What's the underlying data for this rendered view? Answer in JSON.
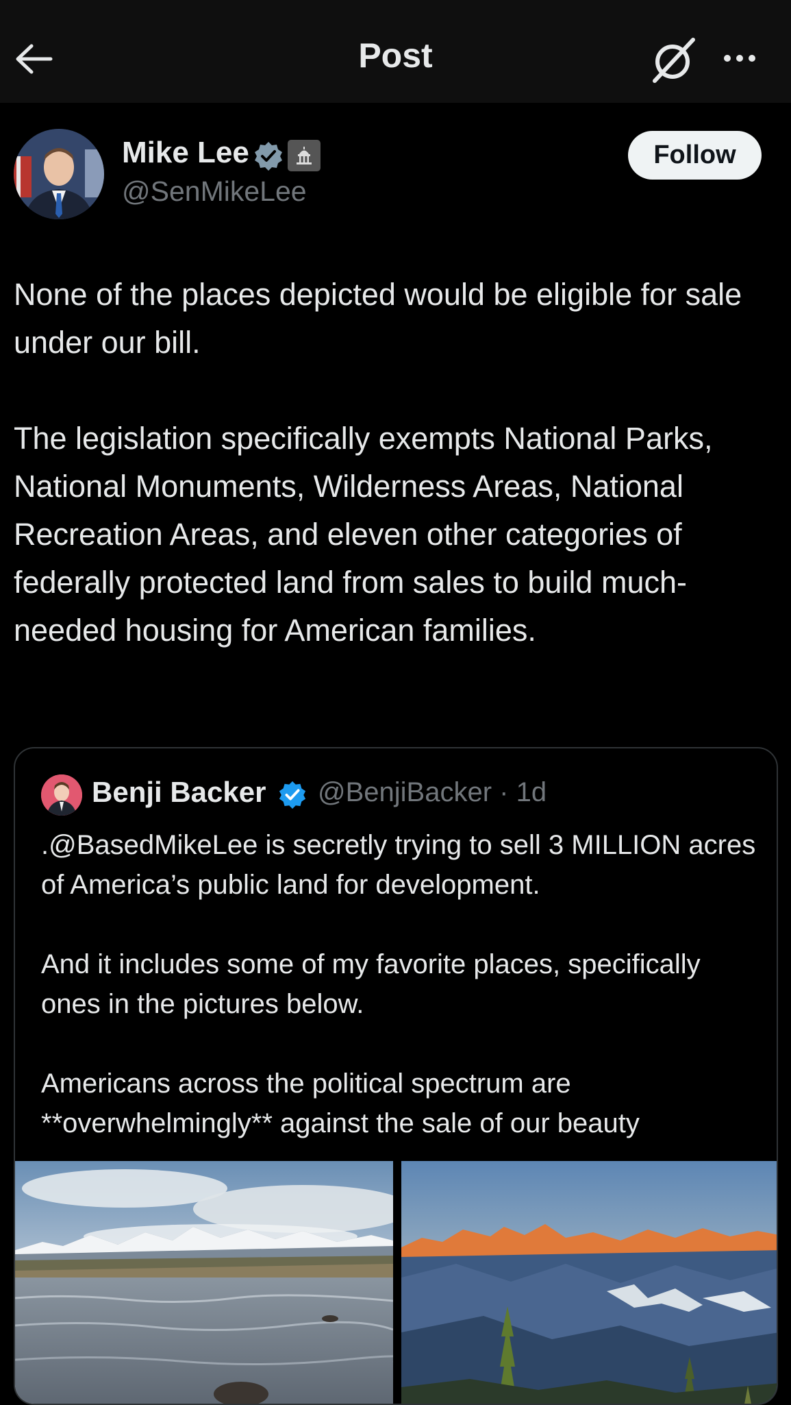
{
  "header": {
    "title": "Post"
  },
  "post": {
    "author_name": "Mike Lee",
    "author_handle": "@SenMikeLee",
    "follow_label": "Follow",
    "paragraphs": [
      "None of the places depicted would be eligible for sale under our bill.",
      "The legislation specifically exempts National Parks, National Monuments, Wilderness Areas, National Recreation Areas, and eleven other categories of federally protected land from sales to build much-needed housing for American families."
    ]
  },
  "quote": {
    "author_name": "Benji Backer",
    "author_handle": "@BenjiBacker · 1d",
    "paragraphs": [
      ".@BasedMikeLee is secretly trying to sell 3 MILLION acres of America’s public land for development.",
      "And it includes some of my favorite places, specifically ones in the pictures below.",
      "Americans across the political spectrum are **overwhelmingly** against the sale of our beauty"
    ],
    "images": [
      "lake-mountains-photo",
      "alpine-sunset-photo"
    ]
  },
  "colors": {
    "background": "#000000",
    "header_bg": "#0f0f0f",
    "text": "#e7e9ea",
    "secondary_text": "#71767b",
    "verified_blue": "#1d9bf0",
    "verified_gray": "#829aab"
  }
}
